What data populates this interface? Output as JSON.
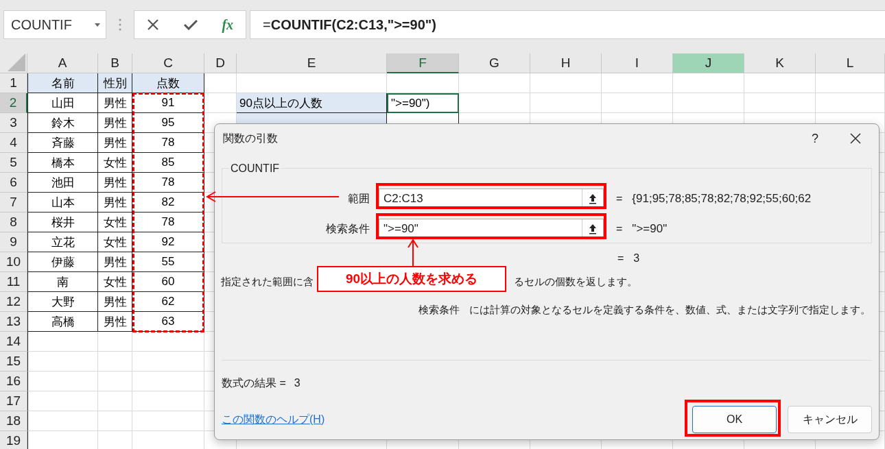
{
  "name_box": {
    "value": "COUNTIF"
  },
  "formula_bar": {
    "fx_label": "fx",
    "formula_prefix": "=",
    "formula_body": "COUNTIF(C2:C13,\">=90\")"
  },
  "columns": [
    {
      "label": "A",
      "selected": false,
      "highlighted": false
    },
    {
      "label": "B",
      "selected": false,
      "highlighted": false
    },
    {
      "label": "C",
      "selected": false,
      "highlighted": false
    },
    {
      "label": "D",
      "selected": false,
      "highlighted": false
    },
    {
      "label": "E",
      "selected": false,
      "highlighted": false
    },
    {
      "label": "F",
      "selected": true,
      "highlighted": false
    },
    {
      "label": "G",
      "selected": false,
      "highlighted": false
    },
    {
      "label": "H",
      "selected": false,
      "highlighted": false
    },
    {
      "label": "I",
      "selected": false,
      "highlighted": false
    },
    {
      "label": "J",
      "selected": false,
      "highlighted": true
    },
    {
      "label": "K",
      "selected": false,
      "highlighted": false
    },
    {
      "label": "L",
      "selected": false,
      "highlighted": false
    }
  ],
  "rows": [
    {
      "number": "1",
      "selected": false,
      "cells": {
        "A": {
          "text": "名前",
          "kind": "header"
        },
        "B": {
          "text": "性別",
          "kind": "header"
        },
        "C": {
          "text": "点数",
          "kind": "header"
        }
      }
    },
    {
      "number": "2",
      "selected": true,
      "cells": {
        "A": {
          "text": "山田",
          "kind": "data"
        },
        "B": {
          "text": "男性",
          "kind": "data"
        },
        "C": {
          "text": "91",
          "kind": "data"
        },
        "E": {
          "text": "90点以上の人数",
          "kind": "label"
        },
        "F": {
          "text": "\">=90\")",
          "kind": "active"
        }
      }
    },
    {
      "number": "3",
      "selected": false,
      "cells": {
        "A": {
          "text": "鈴木",
          "kind": "data"
        },
        "B": {
          "text": "男性",
          "kind": "data"
        },
        "C": {
          "text": "95",
          "kind": "data"
        },
        "E": {
          "kind": "label"
        },
        "F": {
          "kind": "bordered"
        }
      }
    },
    {
      "number": "4",
      "selected": false,
      "cells": {
        "A": {
          "text": "斉藤",
          "kind": "data"
        },
        "B": {
          "text": "男性",
          "kind": "data"
        },
        "C": {
          "text": "78",
          "kind": "data"
        }
      }
    },
    {
      "number": "5",
      "selected": false,
      "cells": {
        "A": {
          "text": "橋本",
          "kind": "data"
        },
        "B": {
          "text": "女性",
          "kind": "data"
        },
        "C": {
          "text": "85",
          "kind": "data"
        }
      }
    },
    {
      "number": "6",
      "selected": false,
      "cells": {
        "A": {
          "text": "池田",
          "kind": "data"
        },
        "B": {
          "text": "男性",
          "kind": "data"
        },
        "C": {
          "text": "78",
          "kind": "data"
        }
      }
    },
    {
      "number": "7",
      "selected": false,
      "cells": {
        "A": {
          "text": "山本",
          "kind": "data"
        },
        "B": {
          "text": "男性",
          "kind": "data"
        },
        "C": {
          "text": "82",
          "kind": "data"
        }
      }
    },
    {
      "number": "8",
      "selected": false,
      "cells": {
        "A": {
          "text": "桜井",
          "kind": "data"
        },
        "B": {
          "text": "女性",
          "kind": "data"
        },
        "C": {
          "text": "78",
          "kind": "data"
        }
      }
    },
    {
      "number": "9",
      "selected": false,
      "cells": {
        "A": {
          "text": "立花",
          "kind": "data"
        },
        "B": {
          "text": "女性",
          "kind": "data"
        },
        "C": {
          "text": "92",
          "kind": "data"
        }
      }
    },
    {
      "number": "10",
      "selected": false,
      "cells": {
        "A": {
          "text": "伊藤",
          "kind": "data"
        },
        "B": {
          "text": "男性",
          "kind": "data"
        },
        "C": {
          "text": "55",
          "kind": "data"
        }
      }
    },
    {
      "number": "11",
      "selected": false,
      "cells": {
        "A": {
          "text": "南",
          "kind": "data"
        },
        "B": {
          "text": "女性",
          "kind": "data"
        },
        "C": {
          "text": "60",
          "kind": "data"
        }
      }
    },
    {
      "number": "12",
      "selected": false,
      "cells": {
        "A": {
          "text": "大野",
          "kind": "data"
        },
        "B": {
          "text": "男性",
          "kind": "data"
        },
        "C": {
          "text": "62",
          "kind": "data"
        }
      }
    },
    {
      "number": "13",
      "selected": false,
      "cells": {
        "A": {
          "text": "高橋",
          "kind": "data"
        },
        "B": {
          "text": "男性",
          "kind": "data"
        },
        "C": {
          "text": "63",
          "kind": "data"
        }
      }
    },
    {
      "number": "14",
      "selected": false
    },
    {
      "number": "15",
      "selected": false
    },
    {
      "number": "16",
      "selected": false
    },
    {
      "number": "17",
      "selected": false
    },
    {
      "number": "18",
      "selected": false
    },
    {
      "number": "19",
      "selected": false
    }
  ],
  "dialog": {
    "title": "関数の引数",
    "help": "?",
    "function_name": "COUNTIF",
    "arguments": [
      {
        "label": "範囲",
        "value": "C2:C13",
        "result": "{91;95;78;85;78;82;78;92;55;60;62"
      },
      {
        "label": "検索条件",
        "value": "\">=90\"",
        "result": "\">=90\""
      }
    ],
    "equals": "=",
    "function_result": "3",
    "description_parts": [
      "指定された範囲に含",
      "るセルの個数を返します。"
    ],
    "argument_name": "検索条件",
    "argument_help": "には計算の対象となるセルを定義する条件を、数値、式、または文字列で指定します。",
    "formula_result_label": "数式の結果 =",
    "formula_result": "3",
    "help_link": "この関数のヘルプ(H)",
    "buttons": [
      "OK",
      "キャンセル"
    ]
  },
  "annotation": {
    "callout": "90以上の人数を求める"
  }
}
